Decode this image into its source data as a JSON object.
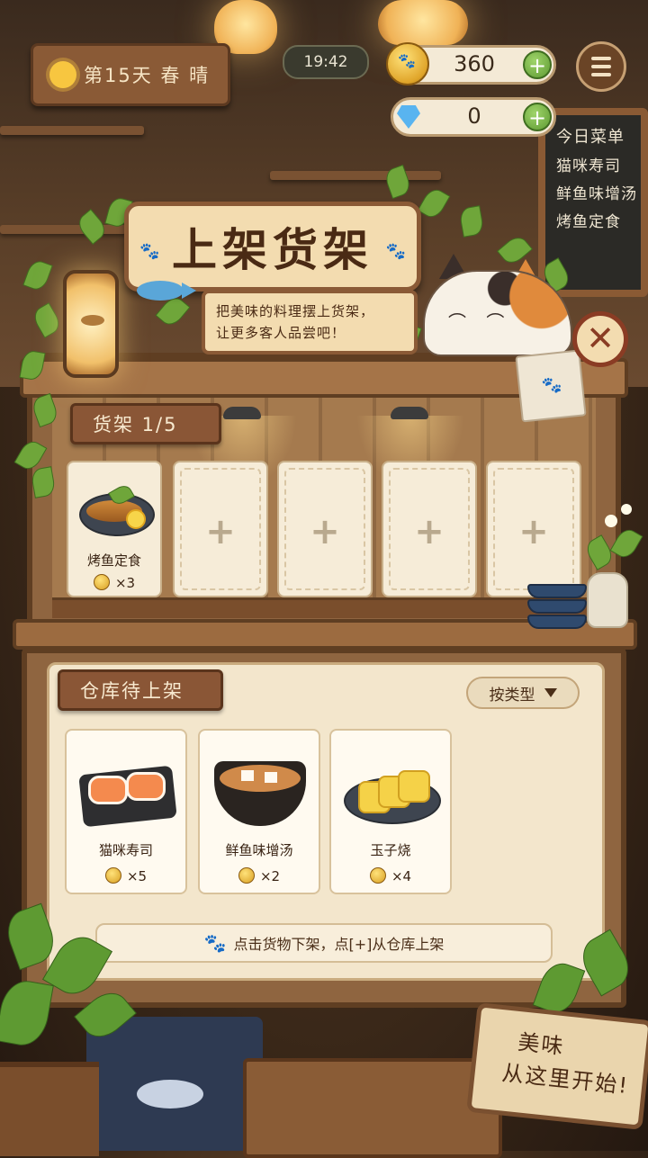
{
  "hud": {
    "date": "第15天 春 晴",
    "time": "19:42",
    "coins": "360",
    "gems": "0"
  },
  "menu_board": {
    "title": "今日菜单",
    "items": [
      "猫咪寿司",
      "鲜鱼味增汤",
      "烤鱼定食"
    ]
  },
  "panel": {
    "title": "上架货架",
    "subtitle_line1": "把美味的料理摆上货架，",
    "subtitle_line2": "让更多客人品尝吧！"
  },
  "shelf": {
    "label": "货架  1/5",
    "slots": [
      {
        "name": "烤鱼定食",
        "qty": "×3"
      },
      {
        "empty": true,
        "label": "+"
      },
      {
        "empty": true,
        "label": "+"
      },
      {
        "empty": true,
        "label": "+"
      },
      {
        "empty": true,
        "label": "+"
      }
    ]
  },
  "warehouse": {
    "label": "仓库待上架",
    "sort_label": "按类型",
    "items": [
      {
        "name": "猫咪寿司",
        "qty": "×5"
      },
      {
        "name": "鲜鱼味增汤",
        "qty": "×2"
      },
      {
        "name": "玉子烧",
        "qty": "×4"
      }
    ],
    "hint": "点击货物下架，点[+]从仓库上架"
  },
  "bottom_sign": {
    "line1": "美味",
    "line2": "从这里开始!"
  },
  "colors": {
    "wood_dark": "#5f3e22",
    "wood": "#8a5636",
    "parchment": "#f3e6cc",
    "accent_green": "#5e9a32",
    "close_red": "#8a3c24"
  }
}
